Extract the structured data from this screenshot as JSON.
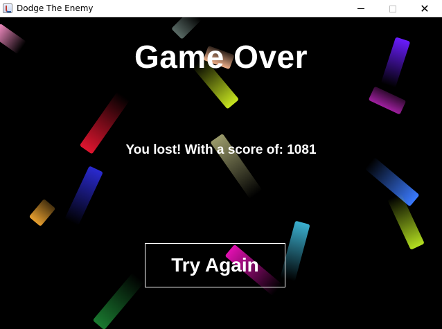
{
  "window": {
    "title": "Dodge The Enemy",
    "icon": "java-cup-icon",
    "controls": {
      "minimize": "minimize-icon",
      "maximize": "maximize-icon",
      "close": "close-icon"
    }
  },
  "game": {
    "heading": "Game Over",
    "message": "You lost! With a score of: 1081",
    "button_label": "Try Again",
    "background_color": "#000000",
    "text_color": "#ffffff",
    "enemy_colors": [
      "#f08ac0",
      "#5a6b66",
      "#f0b08a",
      "#c8e620",
      "#e0152f",
      "#9a9a6a",
      "#2a2ad0",
      "#e8a030",
      "#e010b0",
      "#3bb0d0",
      "#6a1cff",
      "#a020a0",
      "#3a7aff",
      "#b4e020",
      "#1a7a30"
    ]
  }
}
